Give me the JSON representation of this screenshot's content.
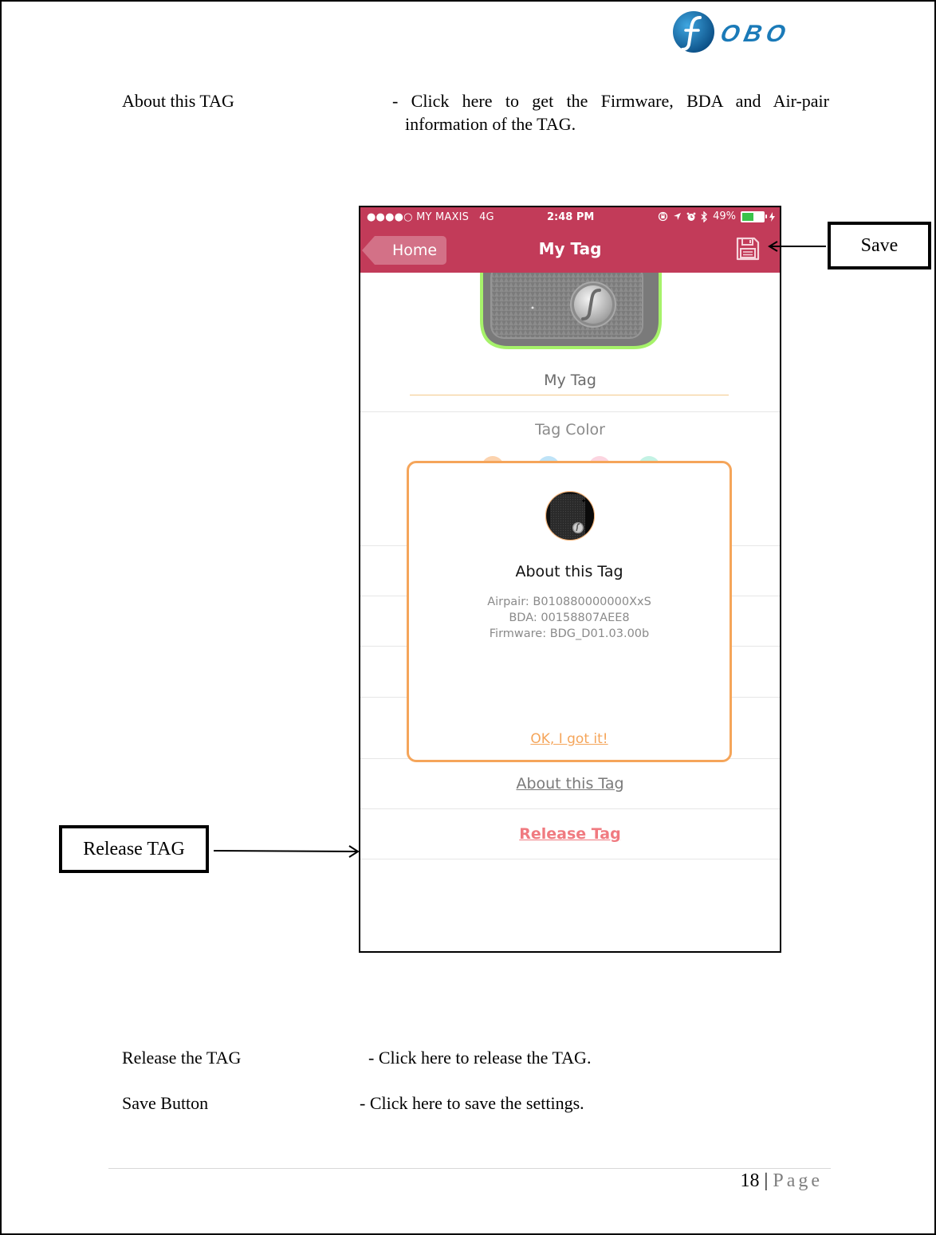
{
  "logo": {
    "brand": "OBO",
    "mark": "f",
    "brand_color": "#1a7ab8"
  },
  "doc": {
    "top_item": {
      "term": "About this TAG",
      "desc_line1": "- Click here to get the Firmware, BDA and Air-pair",
      "desc_line2": "information of the TAG."
    },
    "bottom_items": [
      {
        "term": "Release the TAG",
        "desc": "- Click here to release the TAG."
      },
      {
        "term": "Save Button",
        "desc": "- Click here to save the settings."
      }
    ]
  },
  "callouts": {
    "save": "Save",
    "release": "Release TAG"
  },
  "phone": {
    "status_bar": {
      "signal": "●●●●○",
      "carrier": "MY MAXIS",
      "network": "4G",
      "time": "2:48 PM",
      "battery_percent": "49%",
      "battery_level": 0.49,
      "icons": [
        "rotation-lock-icon",
        "location-icon",
        "alarm-icon",
        "bluetooth-icon",
        "charging-icon"
      ]
    },
    "nav": {
      "back_label": "Home",
      "title": "My Tag",
      "color": "#c23b59"
    },
    "tag_name": "My Tag",
    "tag_color_label": "Tag Color",
    "swatches": [
      "#fcd3ae",
      "#bfe3f7",
      "#fcd5e0",
      "#c4f2e4"
    ],
    "about_link": "About this Tag",
    "release_link": "Release Tag",
    "modal": {
      "title": "About this Tag",
      "airpair": "Airpair: B010880000000XxS",
      "bda": "BDA: 00158807AEE8",
      "firmware": "Firmware: BDG_D01.03.00b",
      "ok_label": "OK, I got it!",
      "accent": "#f5a55a"
    }
  },
  "footer": {
    "page_number": "18",
    "separator": "|",
    "page_label": "Page"
  }
}
